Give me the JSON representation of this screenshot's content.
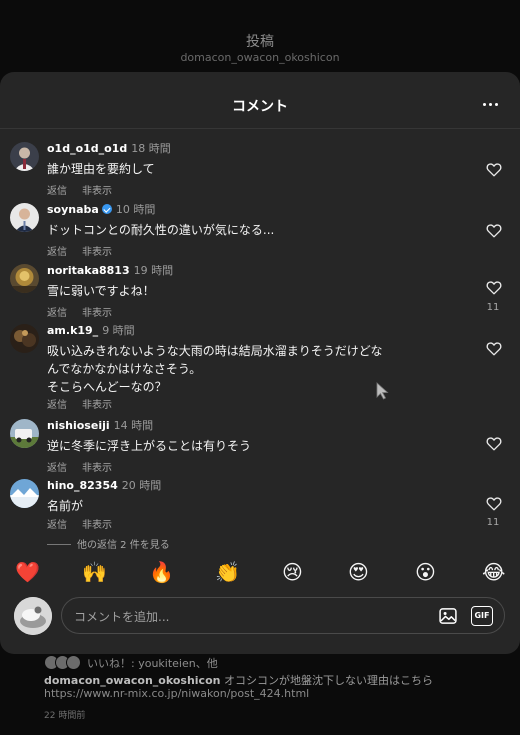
{
  "background": {
    "title": "投稿",
    "username": "domacon_owacon_okoshicon",
    "likes_text": "いいね！: youkiteien、他",
    "caption_user": "domacon_owacon_okoshicon",
    "caption_text": "オコシコンが地盤沈下しない理由はこちら",
    "caption_url": "https://www.nr-mix.co.jp/niwakon/post_424.html",
    "post_time": "22 時間前"
  },
  "sheet": {
    "title": "コメント"
  },
  "actions": {
    "reply": "返信",
    "hide": "非表示"
  },
  "comments": [
    {
      "user": "o1d_o1d_o1d",
      "time": "18 時間",
      "text": "誰か理由を要約して",
      "likes": ""
    },
    {
      "user": "soynaba",
      "verified": true,
      "time": "10 時間",
      "text": "ドットコンとの耐久性の違いが気になる...",
      "likes": ""
    },
    {
      "user": "noritaka8813",
      "time": "19 時間",
      "text": "雪に弱いですよね！",
      "likes": "11"
    },
    {
      "user": "am.k19_",
      "time": "9 時間",
      "text": "吸い込みきれないような大雨の時は結局水溜まりそうだけどな\nんでなかなかはけなさそう。\nそこらへんどーなの？",
      "likes": ""
    },
    {
      "user": "nishioseiji",
      "time": "14 時間",
      "text": "逆に冬季に浮き上がることは有りそう",
      "likes": ""
    },
    {
      "user": "hino_82354",
      "time": "20 時間",
      "text": "名前が",
      "likes": "11"
    }
  ],
  "view_replies": "他の返信 2 件を見る",
  "emojis": [
    "❤️",
    "🙌",
    "🔥",
    "👏",
    "😢",
    "😍",
    "😮",
    "😂"
  ],
  "composer": {
    "placeholder": "コメントを追加...",
    "gif_label": "GIF"
  },
  "colors": {
    "sheet_bg": "#262626",
    "page_bg": "#0b0b0b",
    "verified": "#3897f0"
  }
}
